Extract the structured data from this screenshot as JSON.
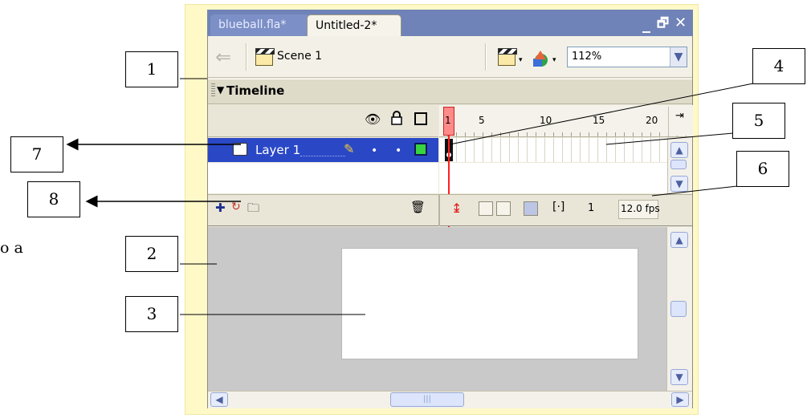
{
  "window": {
    "tabs": [
      "blueball.fla*",
      "Untitled-2*"
    ],
    "controls": {
      "minimize": "_",
      "restore": "🗗",
      "close": "✕"
    }
  },
  "toolbar": {
    "scene_label": "Scene 1",
    "zoom_value": "112%"
  },
  "timeline": {
    "title": "Timeline",
    "ruler_numbers": [
      "1",
      "5",
      "10",
      "15",
      "20"
    ],
    "layer_name": "Layer 1",
    "current_frame": "1",
    "frame_rate": "12.0 fps"
  },
  "callouts": [
    "1",
    "2",
    "3",
    "4",
    "5",
    "6",
    "7",
    "8"
  ],
  "side_text": "o a",
  "colors": {
    "tab_strip": "#6f83b8",
    "layer_selected": "#2a48c6",
    "playhead": "#ff2020",
    "frame_background": "#fff9c8"
  }
}
